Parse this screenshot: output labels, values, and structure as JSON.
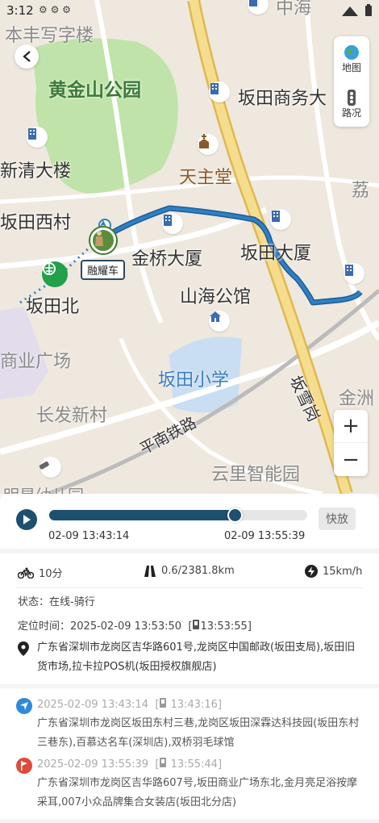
{
  "status_bar": {
    "time": "3:12"
  },
  "map": {
    "labels": {
      "benfeng": "本丰写字楼",
      "huangjinshan": "黄金山公园",
      "bantian_business": "坂田商务大",
      "xinqing": "新清大楼",
      "tianzhutang": "天主堂",
      "lizhi": "荔",
      "bantian_xicun": "坂田西村",
      "jinqiao": "金桥大厦",
      "bantian_dasha": "坂田大厦",
      "bantian_bei": "坂田北",
      "shanhai": "山海公馆",
      "shangye": "商业广场",
      "bantian_xiaoxue": "坂田小学",
      "jinzhou": "金洲",
      "changfa": "长发新村",
      "bangxue": "坂雪岗",
      "pingnan": "平南铁路",
      "yunli": "云里智能园",
      "mingxing": "明星幼儿园",
      "zhonghai": "中海"
    },
    "car_label": "融耀车",
    "layer_buttons": [
      {
        "label": "地图"
      },
      {
        "label": "路况"
      }
    ],
    "zoom_in": "+",
    "zoom_out": "−",
    "colors": {
      "route": "#2f7fc4",
      "track_dotted": "#2f7fc4",
      "main_road": "#f2d27a",
      "park": "#bfe3a8",
      "water": "#c9def2"
    }
  },
  "playback": {
    "progress": 0.72,
    "start_time": "02-09 13:43:14",
    "end_time": "02-09 13:55:39",
    "speed_label": "快放"
  },
  "trip": {
    "duration": "10分",
    "distance": "0.6/2381.8km",
    "speed": "15km/h",
    "status": "状态：在线-骑行",
    "locate_label": "定位时间：2025-02-09 13:53:50",
    "locate_gps": "13:53:55",
    "address": "广东省深圳市龙岗区吉华路601号,龙岗区中国邮政(坂田支局),坂田旧货市场,拉卡拉POS机(坂田授权旗舰店)"
  },
  "route": {
    "start": {
      "time": "2025-02-09 13:43:14",
      "gps_time": "13:43:16",
      "address": "广东省深圳市龙岗区坂田东村三巷,龙岗区坂田深霖达科技园(坂田东村三巷东),百慕达名车(深圳店),双桥羽毛球馆"
    },
    "end": {
      "time": "2025-02-09 13:55:39",
      "gps_time": "13:55:44",
      "address": "广东省深圳市龙岗区吉华路607号,坂田商业广场东北,金月亮足浴按摩采耳,007小众品牌集合女装店(坂田北分店)"
    }
  }
}
